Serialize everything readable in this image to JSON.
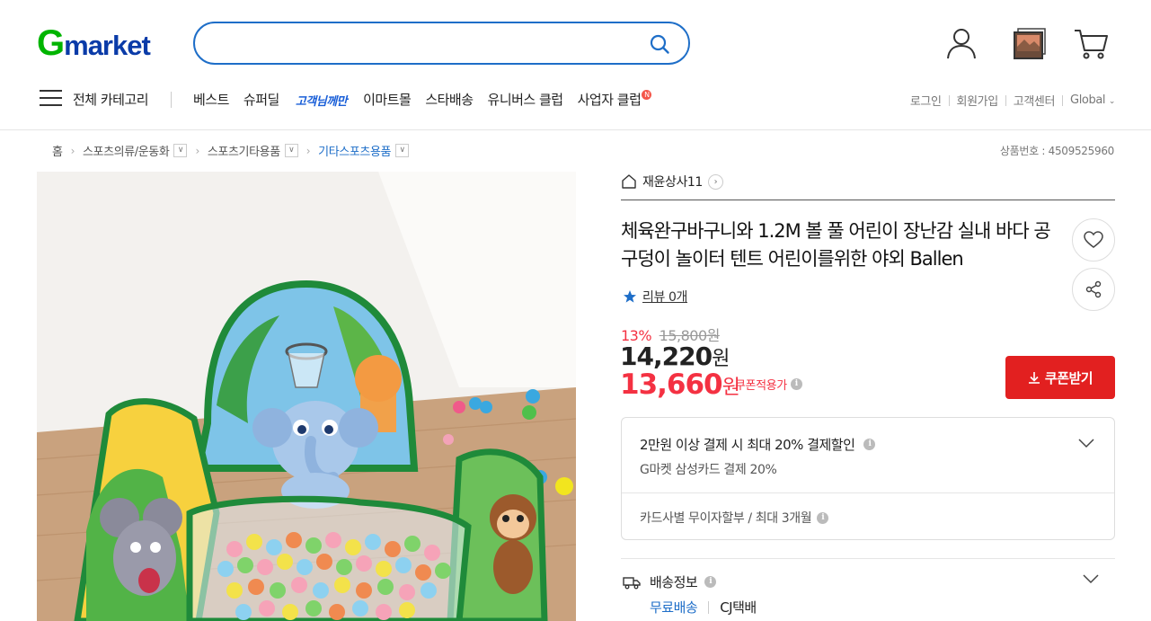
{
  "header": {
    "logo_g": "G",
    "logo_rest": "market",
    "search_placeholder": "",
    "icons": [
      "user-icon",
      "recent-viewed-icon",
      "cart-icon"
    ]
  },
  "nav": {
    "all_categories": "전체 카테고리",
    "items": [
      {
        "label": "베스트"
      },
      {
        "label": "슈퍼딜"
      },
      {
        "label": "고객님께만"
      },
      {
        "label": "이마트몰"
      },
      {
        "label": "스타배송"
      },
      {
        "label": "유니버스 클럽"
      },
      {
        "label": "사업자 클럽",
        "badge": "N"
      }
    ],
    "util": [
      "로그인",
      "회원가입",
      "고객센터",
      "Global"
    ]
  },
  "breadcrumb": {
    "home": "홈",
    "levels": [
      "스포츠의류/운동화",
      "스포츠기타용품",
      "기타스포츠용품"
    ]
  },
  "product_number": "상품번호 : 4509525960",
  "store": {
    "name": "재윤상사11"
  },
  "product": {
    "title": "체육완구바구니와 1.2M 볼 풀 어린이 장난감 실내 바다 공 구덩이 놀이터 텐트 어린이를위한 야외 Ballen",
    "review": "리뷰 0개",
    "discount_rate": "13%",
    "original_price": "15,800원",
    "price_number": "14,220",
    "price_unit": "원",
    "coupon_price_number": "13,660",
    "coupon_price_unit": "원",
    "coupon_note": "쿠폰적용가",
    "coupon_button": "쿠폰받기"
  },
  "benefits": {
    "title": "2만원 이상 결제 시 최대 20% 결제할인",
    "subtitle": "G마켓 삼성카드 결제 20%",
    "installment": "카드사별 무이자할부 / 최대 3개월"
  },
  "shipping": {
    "title": "배송정보",
    "free": "무료배송",
    "carrier": "CJ택배"
  },
  "colors": {
    "brand_green": "#00b400",
    "brand_blue": "#0a3ba8",
    "accent_red": "#f43142",
    "button_red": "#e22020",
    "link_blue": "#1e6ec8"
  }
}
